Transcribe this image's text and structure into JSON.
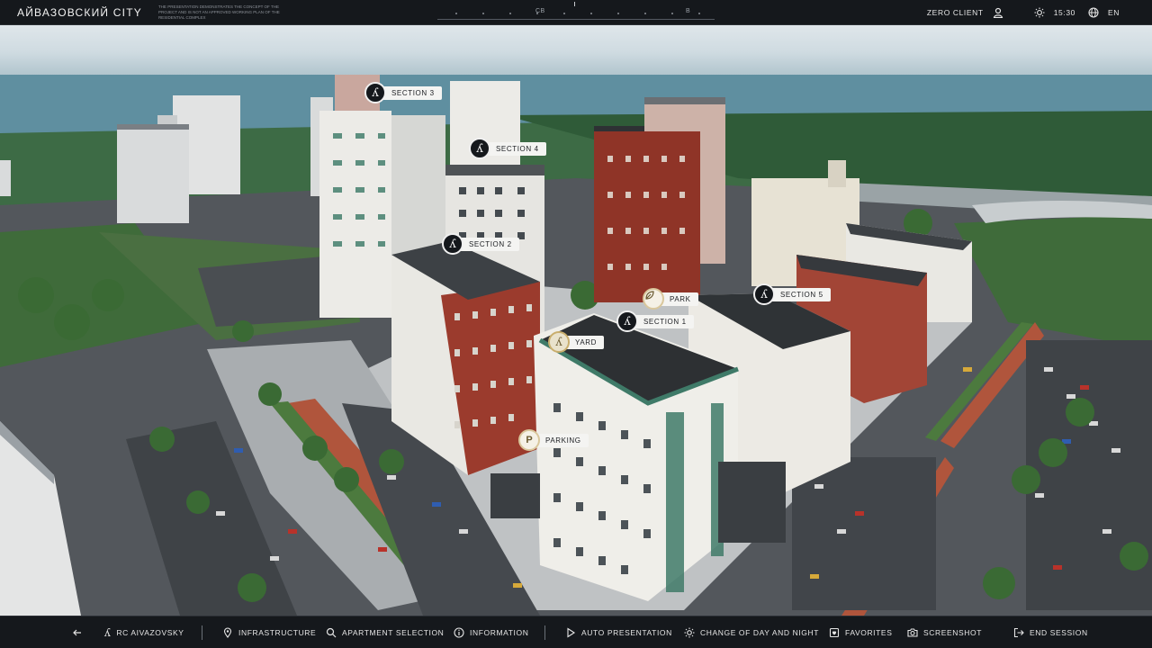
{
  "header": {
    "brand": "АЙВАЗОВСКИЙ CITY",
    "disclaimer": "THE PRESENTATION DEMONSTRATES THE CONCEPT OF THE PROJECT AND IS NOT AN APPROVED WORKING PLAN OF THE RESIDENTIAL COMPLEX",
    "compass": {
      "center": "СВ",
      "right": "В"
    },
    "user": "ZERO CLIENT",
    "user_icon": "user-icon",
    "time": "15:30",
    "time_icon": "sun-icon",
    "language": "EN",
    "language_icon": "globe-icon"
  },
  "map_labels": {
    "section_3": "SECTION 3",
    "section_4": "SECTION 4",
    "section_2": "SECTION 2",
    "park": "PARK",
    "section_5": "SECTION 5",
    "section_1": "SECTION 1",
    "yard": "YARD",
    "parking": "PARKING",
    "section_glyph": "ʎ",
    "parking_glyph": "P"
  },
  "footer": {
    "back_icon": "arrow-left-icon",
    "project": "RC AIVAZOVSKY",
    "infrastructure": "INFRASTRUCTURE",
    "apartment_selection": "APARTMENT SELECTION",
    "information": "INFORMATION",
    "auto_presentation": "AUTO PRESENTATION",
    "day_night": "CHANGE OF DAY AND NIGHT",
    "favorites": "FAVORITES",
    "screenshot": "SCREENSHOT",
    "end_session": "END SESSION"
  },
  "colors": {
    "bar_bg": "#15181c",
    "label_bg": "#f4f4f2",
    "brick": "#9a3a2c",
    "facade": "#e8e6e0",
    "trim": "#3f7a68"
  }
}
